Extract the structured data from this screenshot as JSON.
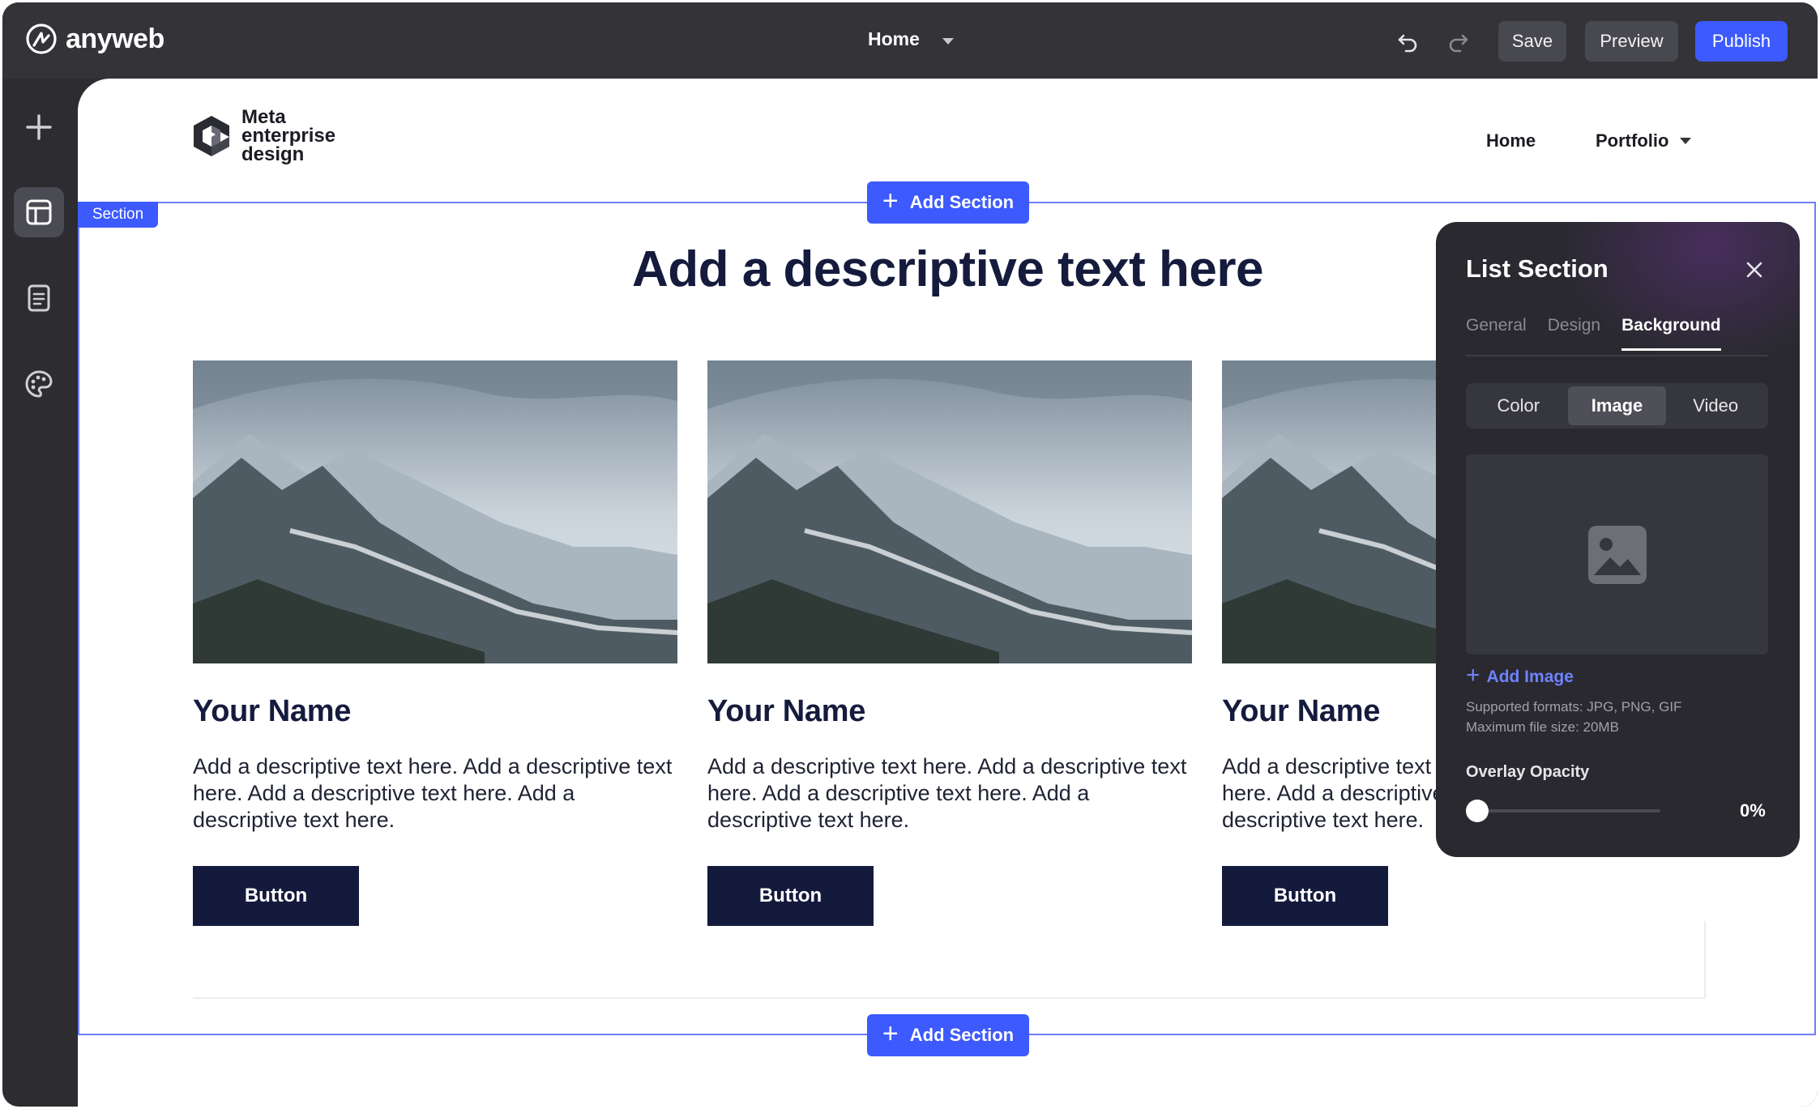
{
  "app": {
    "brand": "anyweb"
  },
  "topbar": {
    "page_selector": "Home",
    "save_label": "Save",
    "preview_label": "Preview",
    "publish_label": "Publish",
    "icons": {
      "undo": "undo-icon",
      "redo": "redo-icon",
      "caret": "chevron-down-icon"
    }
  },
  "rail": {
    "items": [
      {
        "icon": "plus-icon"
      },
      {
        "icon": "layout-icon",
        "active": true
      },
      {
        "icon": "page-icon"
      },
      {
        "icon": "palette-icon"
      }
    ]
  },
  "site": {
    "logo_lines": [
      "Meta",
      "enterprise",
      "design"
    ],
    "nav": {
      "home": "Home",
      "portfolio": "Portfolio"
    }
  },
  "section": {
    "tag": "Section",
    "add_section_label": "Add Section",
    "headline": "Add a descriptive text here",
    "cards": [
      {
        "title": "Your Name",
        "text": "Add a descriptive text here.  Add a descriptive text here. Add a descriptive text here.  Add a descriptive text here.",
        "button": "Button"
      },
      {
        "title": "Your Name",
        "text": "Add a descriptive text here.  Add a descriptive text here. Add a descriptive text here.  Add a descriptive text here.",
        "button": "Button"
      },
      {
        "title": "Your Name",
        "text": "Add a descriptive text here.  Add a descriptive text here. Add a descriptive text here.  Add a descriptive text here.",
        "button": "Button"
      }
    ]
  },
  "panel": {
    "title": "List Section",
    "tabs": [
      "General",
      "Design",
      "Background"
    ],
    "active_tab": "Background",
    "bg_types": [
      "Color",
      "Image",
      "Video"
    ],
    "active_bg_type": "Image",
    "add_image_label": "Add Image",
    "formats_line1": "Supported formats: JPG, PNG, GIF",
    "formats_line2": "Maximum file size: 20MB",
    "overlay_label": "Overlay Opacity",
    "overlay_value": "0%",
    "overlay_fraction": 0
  },
  "colors": {
    "accent": "#3d5afe",
    "topbar": "#333338",
    "rail": "#2c2c31",
    "panel": "#29292f",
    "navy": "#141a3c"
  }
}
